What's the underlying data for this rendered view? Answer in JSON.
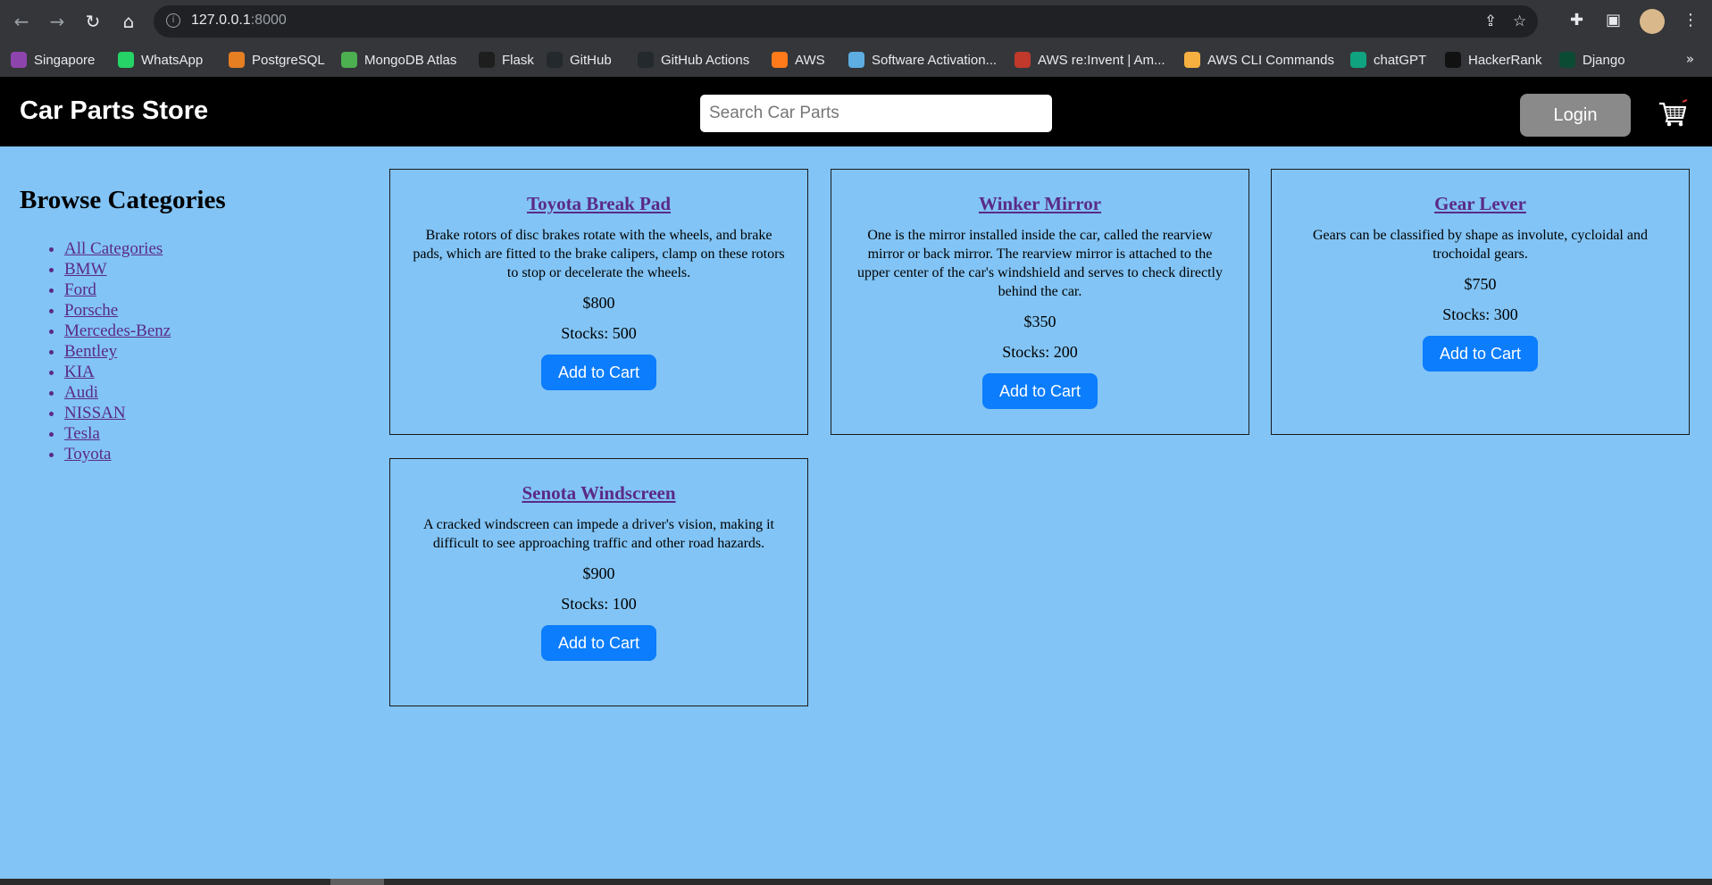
{
  "browser": {
    "url_host": "127.0.0.1",
    "url_port": ":8000",
    "bookmarks": [
      {
        "label": "Singapore",
        "color": "#8e44ad"
      },
      {
        "label": "WhatsApp",
        "color": "#25d366"
      },
      {
        "label": "PostgreSQL",
        "color": "#e67e22"
      },
      {
        "label": "MongoDB Atlas",
        "color": "#4caf50"
      },
      {
        "label": "Flask",
        "color": "#1e1e1e"
      },
      {
        "label": "GitHub",
        "color": "#24292e"
      },
      {
        "label": "GitHub Actions",
        "color": "#24292e"
      },
      {
        "label": "AWS",
        "color": "#ff7a1a"
      },
      {
        "label": "Software Activation...",
        "color": "#5dade2"
      },
      {
        "label": "AWS re:Invent | Am...",
        "color": "#c0392b"
      },
      {
        "label": "AWS CLI Commands",
        "color": "#f5b041"
      },
      {
        "label": "chatGPT",
        "color": "#10a37f"
      },
      {
        "label": "HackerRank",
        "color": "#111111"
      },
      {
        "label": "Django",
        "color": "#0c4b33"
      }
    ],
    "bookmarks_more": "»"
  },
  "header": {
    "brand": "Car Parts Store",
    "search_placeholder": "Search Car Parts",
    "login_label": "Login",
    "cart_icon": "shopping-cart-icon"
  },
  "sidebar": {
    "title": "Browse Categories",
    "categories": [
      "All Categories",
      "BMW",
      "Ford",
      "Porsche",
      "Mercedes-Benz",
      "Bentley",
      "KIA",
      "Audi",
      "NISSAN",
      "Tesla",
      "Toyota"
    ]
  },
  "products": [
    {
      "name": "Toyota Break Pad",
      "description": "Brake rotors of disc brakes rotate with the wheels, and brake pads, which are fitted to the brake calipers, clamp on these rotors to stop or decelerate the wheels.",
      "price": "$800",
      "stock": "Stocks: 500",
      "button": "Add to Cart"
    },
    {
      "name": "Winker Mirror",
      "description": "One is the mirror installed inside the car, called the rearview mirror or back mirror. The rearview mirror is attached to the upper center of the car's windshield and serves to check directly behind the car.",
      "price": "$350",
      "stock": "Stocks: 200",
      "button": "Add to Cart"
    },
    {
      "name": "Gear Lever",
      "description": "Gears can be classified by shape as involute, cycloidal and trochoidal gears.",
      "price": "$750",
      "stock": "Stocks: 300",
      "button": "Add to Cart"
    },
    {
      "name": "Senota Windscreen",
      "description": "A cracked windscreen can impede a driver's vision, making it difficult to see approaching traffic and other road hazards.",
      "price": "$900",
      "stock": "Stocks: 100",
      "button": "Add to Cart"
    }
  ],
  "colors": {
    "page_bg": "#82c4f5",
    "header_bg": "#000000",
    "button_blue": "#0b7dfd",
    "login_gray": "#8a8a8a",
    "link": "#5a2a88"
  }
}
